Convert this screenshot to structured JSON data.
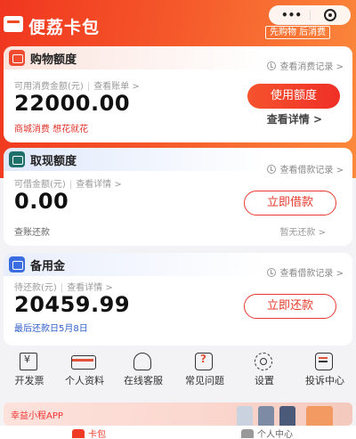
{
  "header": {
    "app_title": "便荔卡包",
    "capsule_more": "•••",
    "slogan": "先购物 后消费"
  },
  "shopping_card": {
    "title": "购物额度",
    "record_link": "查看消费记录 >",
    "sub_label": "可用消费金额(元)",
    "sub_link": "查看账单 >",
    "amount": "22000.00",
    "note": "商城消费 想花就花",
    "button": "使用额度",
    "detail_link": "查看详情 >"
  },
  "cash_card": {
    "title": "取现额度",
    "record_link": "查看借款记录 >",
    "sub_label": "可借金额(元)",
    "sub_link": "查看详情 >",
    "amount": "0.00",
    "note": "查账还款",
    "button": "立即借款",
    "right_note": "暂无还款 >"
  },
  "reserve_card": {
    "title": "备用金",
    "record_link": "查看借款记录 >",
    "sub_label": "待还款(元)",
    "sub_link": "查看详情 >",
    "amount": "20459.99",
    "note": "最后还款日5月8日",
    "button": "立即还款"
  },
  "services": [
    {
      "label": "开发票",
      "icon": "invoice-icon"
    },
    {
      "label": "个人资料",
      "icon": "profile-card-icon"
    },
    {
      "label": "在线客服",
      "icon": "headset-icon"
    },
    {
      "label": "常见问题",
      "icon": "faq-icon"
    },
    {
      "label": "设置",
      "icon": "gear-icon"
    },
    {
      "label": "投诉中心",
      "icon": "complaint-icon"
    }
  ],
  "banner": {
    "text": "幸益小程APP"
  },
  "tabbar": {
    "tabs": [
      {
        "label": "卡包",
        "icon": "wallet-icon"
      },
      {
        "label": "个人中心",
        "icon": "user-icon"
      }
    ]
  },
  "colors": {
    "brand_red": "#ef3a26",
    "brand_orange": "#fb8a3c",
    "link_blue": "#2f5fc9",
    "note_red": "#e0332a"
  }
}
